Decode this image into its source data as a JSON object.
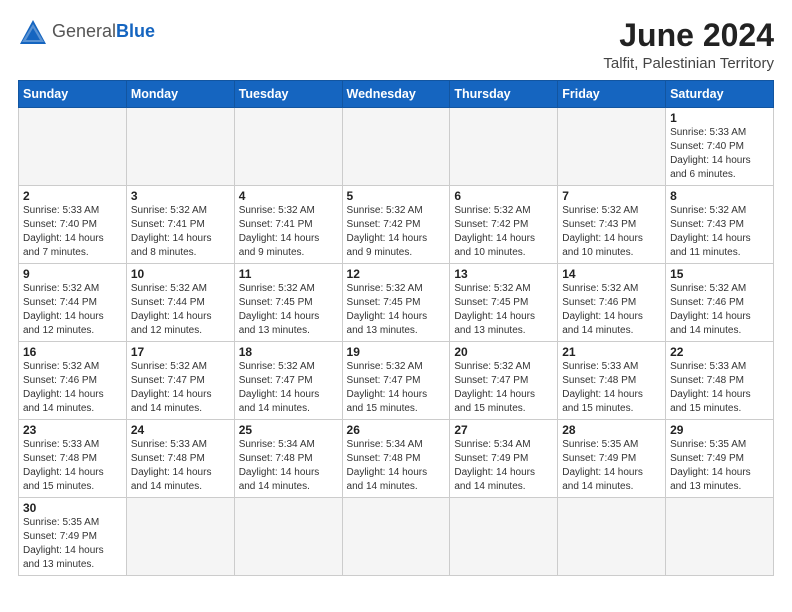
{
  "header": {
    "logo_general": "General",
    "logo_blue": "Blue",
    "title": "June 2024",
    "subtitle": "Talfit, Palestinian Territory"
  },
  "weekdays": [
    "Sunday",
    "Monday",
    "Tuesday",
    "Wednesday",
    "Thursday",
    "Friday",
    "Saturday"
  ],
  "weeks": [
    [
      {
        "day": "",
        "info": ""
      },
      {
        "day": "",
        "info": ""
      },
      {
        "day": "",
        "info": ""
      },
      {
        "day": "",
        "info": ""
      },
      {
        "day": "",
        "info": ""
      },
      {
        "day": "",
        "info": ""
      },
      {
        "day": "1",
        "info": "Sunrise: 5:33 AM\nSunset: 7:40 PM\nDaylight: 14 hours\nand 6 minutes."
      }
    ],
    [
      {
        "day": "2",
        "info": "Sunrise: 5:33 AM\nSunset: 7:40 PM\nDaylight: 14 hours\nand 7 minutes."
      },
      {
        "day": "3",
        "info": "Sunrise: 5:32 AM\nSunset: 7:41 PM\nDaylight: 14 hours\nand 8 minutes."
      },
      {
        "day": "4",
        "info": "Sunrise: 5:32 AM\nSunset: 7:41 PM\nDaylight: 14 hours\nand 9 minutes."
      },
      {
        "day": "5",
        "info": "Sunrise: 5:32 AM\nSunset: 7:42 PM\nDaylight: 14 hours\nand 9 minutes."
      },
      {
        "day": "6",
        "info": "Sunrise: 5:32 AM\nSunset: 7:42 PM\nDaylight: 14 hours\nand 10 minutes."
      },
      {
        "day": "7",
        "info": "Sunrise: 5:32 AM\nSunset: 7:43 PM\nDaylight: 14 hours\nand 10 minutes."
      },
      {
        "day": "8",
        "info": "Sunrise: 5:32 AM\nSunset: 7:43 PM\nDaylight: 14 hours\nand 11 minutes."
      }
    ],
    [
      {
        "day": "9",
        "info": "Sunrise: 5:32 AM\nSunset: 7:44 PM\nDaylight: 14 hours\nand 12 minutes."
      },
      {
        "day": "10",
        "info": "Sunrise: 5:32 AM\nSunset: 7:44 PM\nDaylight: 14 hours\nand 12 minutes."
      },
      {
        "day": "11",
        "info": "Sunrise: 5:32 AM\nSunset: 7:45 PM\nDaylight: 14 hours\nand 13 minutes."
      },
      {
        "day": "12",
        "info": "Sunrise: 5:32 AM\nSunset: 7:45 PM\nDaylight: 14 hours\nand 13 minutes."
      },
      {
        "day": "13",
        "info": "Sunrise: 5:32 AM\nSunset: 7:45 PM\nDaylight: 14 hours\nand 13 minutes."
      },
      {
        "day": "14",
        "info": "Sunrise: 5:32 AM\nSunset: 7:46 PM\nDaylight: 14 hours\nand 14 minutes."
      },
      {
        "day": "15",
        "info": "Sunrise: 5:32 AM\nSunset: 7:46 PM\nDaylight: 14 hours\nand 14 minutes."
      }
    ],
    [
      {
        "day": "16",
        "info": "Sunrise: 5:32 AM\nSunset: 7:46 PM\nDaylight: 14 hours\nand 14 minutes."
      },
      {
        "day": "17",
        "info": "Sunrise: 5:32 AM\nSunset: 7:47 PM\nDaylight: 14 hours\nand 14 minutes."
      },
      {
        "day": "18",
        "info": "Sunrise: 5:32 AM\nSunset: 7:47 PM\nDaylight: 14 hours\nand 14 minutes."
      },
      {
        "day": "19",
        "info": "Sunrise: 5:32 AM\nSunset: 7:47 PM\nDaylight: 14 hours\nand 15 minutes."
      },
      {
        "day": "20",
        "info": "Sunrise: 5:32 AM\nSunset: 7:47 PM\nDaylight: 14 hours\nand 15 minutes."
      },
      {
        "day": "21",
        "info": "Sunrise: 5:33 AM\nSunset: 7:48 PM\nDaylight: 14 hours\nand 15 minutes."
      },
      {
        "day": "22",
        "info": "Sunrise: 5:33 AM\nSunset: 7:48 PM\nDaylight: 14 hours\nand 15 minutes."
      }
    ],
    [
      {
        "day": "23",
        "info": "Sunrise: 5:33 AM\nSunset: 7:48 PM\nDaylight: 14 hours\nand 15 minutes."
      },
      {
        "day": "24",
        "info": "Sunrise: 5:33 AM\nSunset: 7:48 PM\nDaylight: 14 hours\nand 14 minutes."
      },
      {
        "day": "25",
        "info": "Sunrise: 5:34 AM\nSunset: 7:48 PM\nDaylight: 14 hours\nand 14 minutes."
      },
      {
        "day": "26",
        "info": "Sunrise: 5:34 AM\nSunset: 7:48 PM\nDaylight: 14 hours\nand 14 minutes."
      },
      {
        "day": "27",
        "info": "Sunrise: 5:34 AM\nSunset: 7:49 PM\nDaylight: 14 hours\nand 14 minutes."
      },
      {
        "day": "28",
        "info": "Sunrise: 5:35 AM\nSunset: 7:49 PM\nDaylight: 14 hours\nand 14 minutes."
      },
      {
        "day": "29",
        "info": "Sunrise: 5:35 AM\nSunset: 7:49 PM\nDaylight: 14 hours\nand 13 minutes."
      }
    ],
    [
      {
        "day": "30",
        "info": "Sunrise: 5:35 AM\nSunset: 7:49 PM\nDaylight: 14 hours\nand 13 minutes."
      },
      {
        "day": "",
        "info": ""
      },
      {
        "day": "",
        "info": ""
      },
      {
        "day": "",
        "info": ""
      },
      {
        "day": "",
        "info": ""
      },
      {
        "day": "",
        "info": ""
      },
      {
        "day": "",
        "info": ""
      }
    ]
  ]
}
